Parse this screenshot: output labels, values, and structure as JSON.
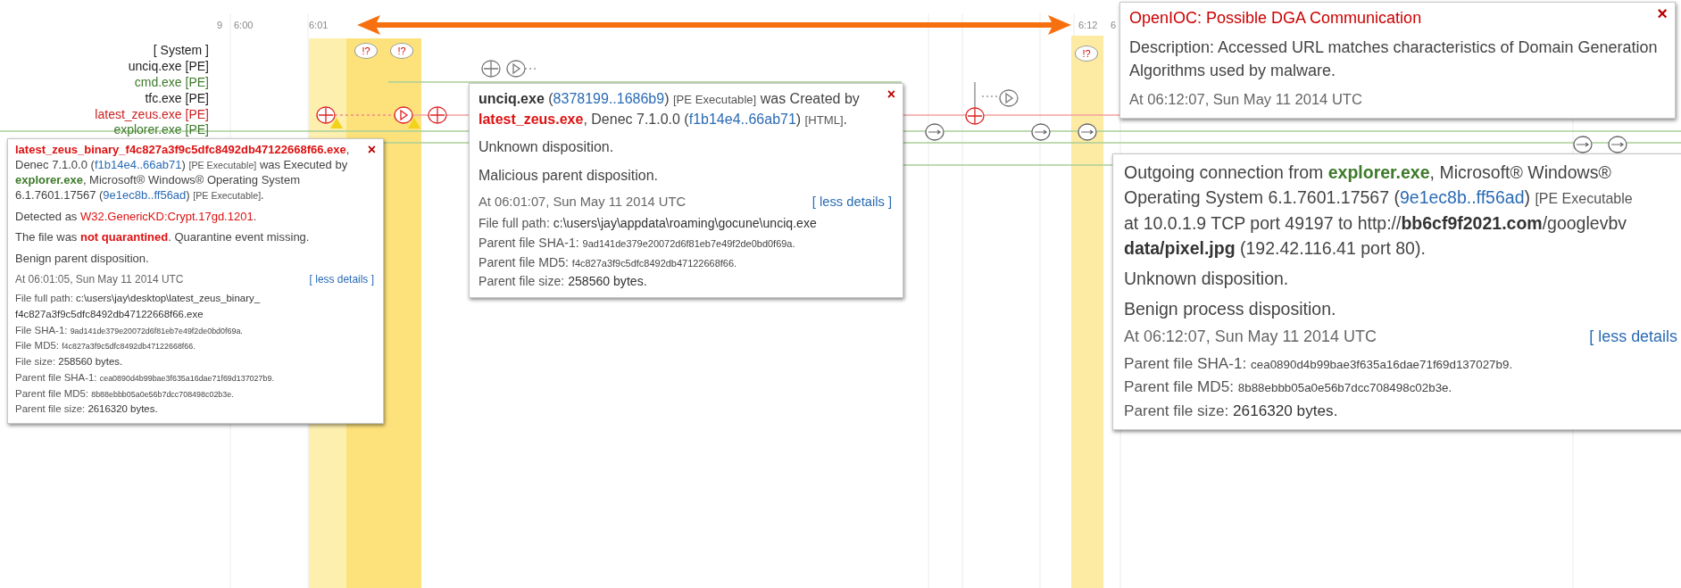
{
  "time_axis": {
    "ticks": [
      {
        "label": "9"
      },
      {
        "label": "6:00"
      },
      {
        "label": "6:01"
      },
      {
        "label": "6:12"
      },
      {
        "label": "6"
      }
    ]
  },
  "rows": [
    {
      "label": "[ System ]",
      "color": "#222222"
    },
    {
      "label": "unciq.exe [PE]",
      "color": "#222222"
    },
    {
      "label": "cmd.exe [PE]",
      "color": "#3d7a2a"
    },
    {
      "label": "tfc.exe [PE]",
      "color": "#222222"
    },
    {
      "label": "latest_zeus.exe [PE]",
      "color": "#cc2222"
    },
    {
      "label": "explorer.exe [PE]",
      "color": "#3d7a2a"
    }
  ],
  "alert_markers": [
    {
      "label": "!?"
    },
    {
      "label": "!?"
    },
    {
      "label": "!?"
    }
  ],
  "popups": [
    {
      "kind": "event",
      "close": "×",
      "summary": [
        {
          "text": "latest_zeus_binary_f4c827a3f9c5dfc8492db47122668f66.exe",
          "kind": "malicious"
        },
        {
          "text": ", Denec 7.1.0.0 (",
          "kind": "text"
        },
        {
          "text": "f1b14e4..66ab71",
          "kind": "link"
        },
        {
          "text": ") ",
          "kind": "text"
        },
        {
          "text": "[PE Executable]",
          "kind": "note"
        },
        {
          "text": " was Executed by ",
          "kind": "text"
        },
        {
          "text": "explorer.exe",
          "kind": "benign"
        },
        {
          "text": ", Microsoft® Windows® Operating System 6.1.7601.17567 (",
          "kind": "text"
        },
        {
          "text": "9e1ec8b..ff56ad",
          "kind": "link"
        },
        {
          "text": ") ",
          "kind": "text"
        },
        {
          "text": "[PE Executable]",
          "kind": "note"
        },
        {
          "text": ".",
          "kind": "text"
        }
      ],
      "paragraphs": [
        [
          {
            "text": "Detected as ",
            "kind": "text"
          },
          {
            "text": "W32.GenericKD:Crypt.17gd.1201",
            "kind": "alert"
          },
          {
            "text": ".",
            "kind": "text"
          }
        ],
        [
          {
            "text": "The file was ",
            "kind": "text"
          },
          {
            "text": "not quarantined",
            "kind": "malicious"
          },
          {
            "text": ". Quarantine event missing.",
            "kind": "text"
          }
        ],
        [
          {
            "text": "Benign parent disposition.",
            "kind": "text"
          }
        ]
      ],
      "timestamp": "At 06:01:05, Sun May 11 2014 UTC",
      "details_link": "[ less details ]",
      "details": [
        {
          "label": "File full path:",
          "value": "c:\\users\\jay\\desktop\\latest_zeus_binary_ f4c827a3f9c5dfc8492db47122668f66.exe",
          "kind": "path"
        },
        {
          "label": "File SHA-1:",
          "value": "9ad141de379e20072d6f81eb7e49f2de0bd0f69a.",
          "kind": "hash"
        },
        {
          "label": "File MD5:",
          "value": "f4c827a3f9c5dfc8492db47122668f66.",
          "kind": "hash"
        },
        {
          "label": "File size:",
          "value": "258560 bytes.",
          "kind": "size"
        },
        {
          "label": "Parent file SHA-1:",
          "value": "cea0890d4b99bae3f635a16dae71f69d137027b9.",
          "kind": "hash"
        },
        {
          "label": "Parent file MD5:",
          "value": "8b88ebbb05a0e56b7dcc708498c02b3e.",
          "kind": "hash"
        },
        {
          "label": "Parent file size:",
          "value": "2616320 bytes.",
          "kind": "size"
        }
      ]
    },
    {
      "kind": "event",
      "close": "×",
      "summary": [
        {
          "text": "unciq.exe",
          "kind": "bold"
        },
        {
          "text": " (",
          "kind": "text"
        },
        {
          "text": "8378199..1686b9",
          "kind": "link"
        },
        {
          "text": ") ",
          "kind": "text"
        },
        {
          "text": "[PE Executable]",
          "kind": "note"
        },
        {
          "text": " was Created by ",
          "kind": "text"
        },
        {
          "text": "latest_zeus.exe",
          "kind": "malicious"
        },
        {
          "text": ", Denec 7.1.0.0 (",
          "kind": "text"
        },
        {
          "text": "f1b14e4..66ab71",
          "kind": "link"
        },
        {
          "text": ") ",
          "kind": "text"
        },
        {
          "text": "[HTML]",
          "kind": "note"
        },
        {
          "text": ".",
          "kind": "text"
        }
      ],
      "paragraphs": [
        [
          {
            "text": "Unknown disposition.",
            "kind": "text"
          }
        ],
        [
          {
            "text": "Malicious parent disposition.",
            "kind": "text"
          }
        ]
      ],
      "timestamp": "At 06:01:07, Sun May 11 2014 UTC",
      "details_link": "[ less details ]",
      "details": [
        {
          "label": "File full path:",
          "value": "c:\\users\\jay\\appdata\\roaming\\gocune\\unciq.exe",
          "kind": "path"
        },
        {
          "label": "Parent file SHA-1:",
          "value": "9ad141de379e20072d6f81eb7e49f2de0bd0f69a.",
          "kind": "hash"
        },
        {
          "label": "Parent file MD5:",
          "value": "f4c827a3f9c5dfc8492db47122668f66.",
          "kind": "hash"
        },
        {
          "label": "Parent file size:",
          "value": "258560 bytes.",
          "kind": "size"
        }
      ]
    },
    {
      "kind": "ioc",
      "close": "×",
      "title": "OpenIOC: Possible DGA Communication",
      "description": "Description: Accessed URL matches characteristics of Domain Generation Algorithms used by malware.",
      "timestamp": "At 06:12:07, Sun May 11 2014 UTC"
    },
    {
      "kind": "event",
      "summary_lines": [
        [
          {
            "text": "Outgoing connection from ",
            "kind": "text"
          },
          {
            "text": "explorer.exe",
            "kind": "benign"
          },
          {
            "text": ", Microsoft® Windows®",
            "kind": "text"
          }
        ],
        [
          {
            "text": "Operating System 6.1.7601.17567 (",
            "kind": "text"
          },
          {
            "text": "9e1ec8b..ff56ad",
            "kind": "link"
          },
          {
            "text": ") ",
            "kind": "text"
          },
          {
            "text": "[PE Executable",
            "kind": "note"
          }
        ],
        [
          {
            "text": "at 10.0.1.9 TCP port 49197 to http://",
            "kind": "text"
          },
          {
            "text": "bb6cf9f2021.com",
            "kind": "bold"
          },
          {
            "text": "/googlevbv",
            "kind": "text"
          }
        ],
        [
          {
            "text": "data/pixel.jpg",
            "kind": "bold"
          },
          {
            "text": " (192.42.116.41 port 80).",
            "kind": "text"
          }
        ]
      ],
      "paragraphs": [
        [
          {
            "text": "Unknown disposition.",
            "kind": "text"
          }
        ],
        [
          {
            "text": "Benign process disposition.",
            "kind": "text"
          }
        ]
      ],
      "timestamp": "At 06:12:07, Sun May 11 2014 UTC",
      "details_link": "[ less details",
      "details": [
        {
          "label": "Parent file SHA-1:",
          "value": "cea0890d4b99bae3f635a16dae71f69d137027b9.",
          "kind": "hash"
        },
        {
          "label": "Parent file MD5:",
          "value": "8b88ebbb05a0e56b7dcc708498c02b3e.",
          "kind": "hash"
        },
        {
          "label": "Parent file size:",
          "value": "2616320 bytes.",
          "kind": "size"
        }
      ]
    }
  ]
}
